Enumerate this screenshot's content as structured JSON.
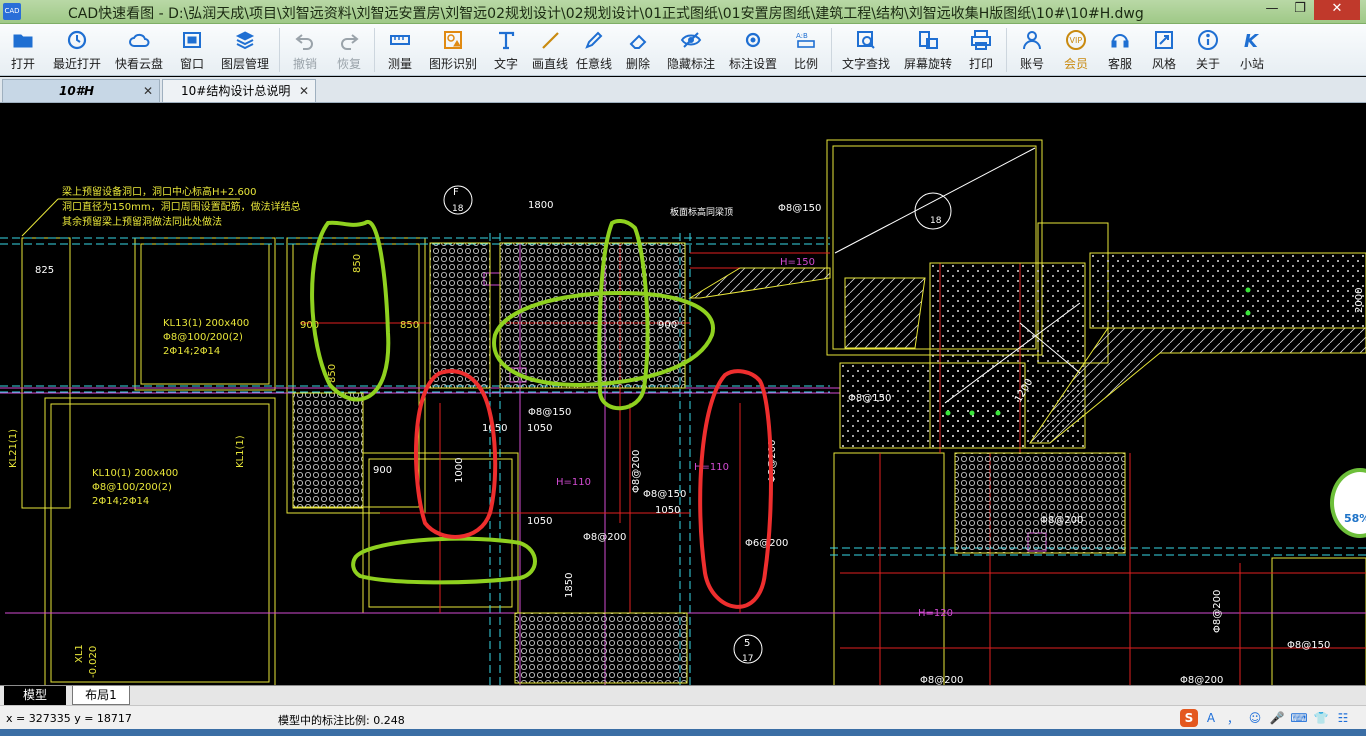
{
  "window": {
    "app_icon_text": "CAD",
    "title": "CAD快速看图 - D:\\弘润天成\\项目\\刘智远资料\\刘智远安置房\\刘智远02规划设计\\02规划设计\\01正式图纸\\01安置房图纸\\建筑工程\\结构\\刘智远收集H版图纸\\10#\\10#H.dwg",
    "controls": {
      "minimize": "—",
      "restore": "❐",
      "close": "✕"
    }
  },
  "toolbar": {
    "items": [
      {
        "label": "打开",
        "icon": "folder-icon",
        "color": "#1f6fd2"
      },
      {
        "label": "最近打开",
        "icon": "history-icon",
        "color": "#1f6fd2"
      },
      {
        "label": "快看云盘",
        "icon": "cloud-icon",
        "color": "#1f6fd2"
      },
      {
        "label": "窗口",
        "icon": "window-icon",
        "color": "#1f6fd2"
      },
      {
        "label": "图层管理",
        "icon": "layers-icon",
        "color": "#1f6fd2"
      },
      {
        "label": "撤销",
        "icon": "undo-icon",
        "color": "#9aa3aa",
        "disabled": true
      },
      {
        "label": "恢复",
        "icon": "redo-icon",
        "color": "#9aa3aa",
        "disabled": true
      },
      {
        "label": "测量",
        "icon": "ruler-icon",
        "color": "#1f6fd2"
      },
      {
        "label": "图形识别",
        "icon": "shape-recognize-icon",
        "color": "#e08a12"
      },
      {
        "label": "文字",
        "icon": "text-icon",
        "color": "#1f6fd2"
      },
      {
        "label": "画直线",
        "icon": "line-icon",
        "color": "#c98a10"
      },
      {
        "label": "任意线",
        "icon": "pen-icon",
        "color": "#1f6fd2"
      },
      {
        "label": "删除",
        "icon": "eraser-icon",
        "color": "#1f6fd2"
      },
      {
        "label": "隐藏标注",
        "icon": "hide-eye-icon",
        "color": "#1f6fd2"
      },
      {
        "label": "标注设置",
        "icon": "annotation-settings-icon",
        "color": "#1f6fd2"
      },
      {
        "label": "比例",
        "icon": "scale-icon",
        "color": "#1f6fd2"
      },
      {
        "label": "文字查找",
        "icon": "text-search-icon",
        "color": "#1f6fd2"
      },
      {
        "label": "屏幕旋转",
        "icon": "rotate-screen-icon",
        "color": "#1f6fd2"
      },
      {
        "label": "打印",
        "icon": "printer-icon",
        "color": "#1f6fd2"
      },
      {
        "label": "账号",
        "icon": "user-icon",
        "color": "#1f6fd2"
      },
      {
        "label": "会员",
        "icon": "vip-icon",
        "color": "#c98a10",
        "vip": true
      },
      {
        "label": "客服",
        "icon": "headset-icon",
        "color": "#1f6fd2"
      },
      {
        "label": "风格",
        "icon": "style-icon",
        "color": "#1f6fd2"
      },
      {
        "label": "关于",
        "icon": "info-icon",
        "color": "#1f6fd2"
      },
      {
        "label": "小站",
        "icon": "k-station-icon",
        "color": "#1f6fd2"
      }
    ]
  },
  "tabs": [
    {
      "label": "10#H",
      "active": true
    },
    {
      "label": "10#结构设计总说明",
      "active": false
    }
  ],
  "drawing": {
    "notes": [
      "梁上预留设备洞口，洞口中心标高H+2.600",
      "洞口直径为150mm，洞口周围设置配筋，做法详结总",
      "其余预留梁上预留洞做法同此处做法"
    ],
    "labels": {
      "kl13": "KL13(1) 200x400",
      "kl13_stirrup": "Φ8@100/200(2)",
      "kl13_bars": "2Φ14;2Φ14",
      "kl10": "KL10(1) 200x400",
      "kl10_stirrup": "Φ8@100/200(2)",
      "kl10_bars": "2Φ14;2Φ14",
      "kl21": "KL21(1)",
      "kl11": "KL1(1)",
      "xl1": "XL1",
      "xl1_level": "-0.020",
      "d825": "825",
      "d1800": "1800",
      "d850a": "850",
      "d850b": "850",
      "d850c": "850",
      "d900a": "900",
      "d900b": "900",
      "d900c": "900",
      "d1050a": "1050",
      "d1050b": "1050",
      "d1050c": "1050",
      "d1050d": "1050",
      "d1000": "1000",
      "d1850": "1850",
      "h110a": "H=110",
      "h110b": "H=110",
      "h120": "H=120",
      "h150": "H=150",
      "r8_150a": "Φ8@150",
      "r8_150b": "Φ8@150",
      "r8_150c": "Φ8@150",
      "r8_150d": "Φ8@150",
      "r8_150e": "Φ8@150",
      "r8_200a": "Φ8@200",
      "r8_200b": "Φ8@200",
      "r8_200c": "Φ8@200",
      "r8_200d": "Φ8@200",
      "r8_200e": "Φ8@200",
      "r8_200f": "Φ8@200",
      "r8_200g": "Φ8@200",
      "r6_200": "Φ6@200",
      "slope_note": "板面标高同梁顶",
      "axis_f": "F",
      "axis_f_sub": "18",
      "axis_5": "5",
      "axis_5_sub": "17",
      "axis_18": "18",
      "d2000": "2000",
      "d1200": "1200"
    }
  },
  "gauge": {
    "value": "58%"
  },
  "layout_tabs": [
    {
      "label": "模型",
      "active": true
    },
    {
      "label": "布局1",
      "active": false
    }
  ],
  "status": {
    "coords": "x = 327335  y = 18717",
    "scale": "模型中的标注比例: 0.248"
  },
  "ime": {
    "logo": "S",
    "items": [
      "A",
      "，",
      "☺",
      "🎤",
      "⌨",
      "👕",
      "☷"
    ]
  }
}
